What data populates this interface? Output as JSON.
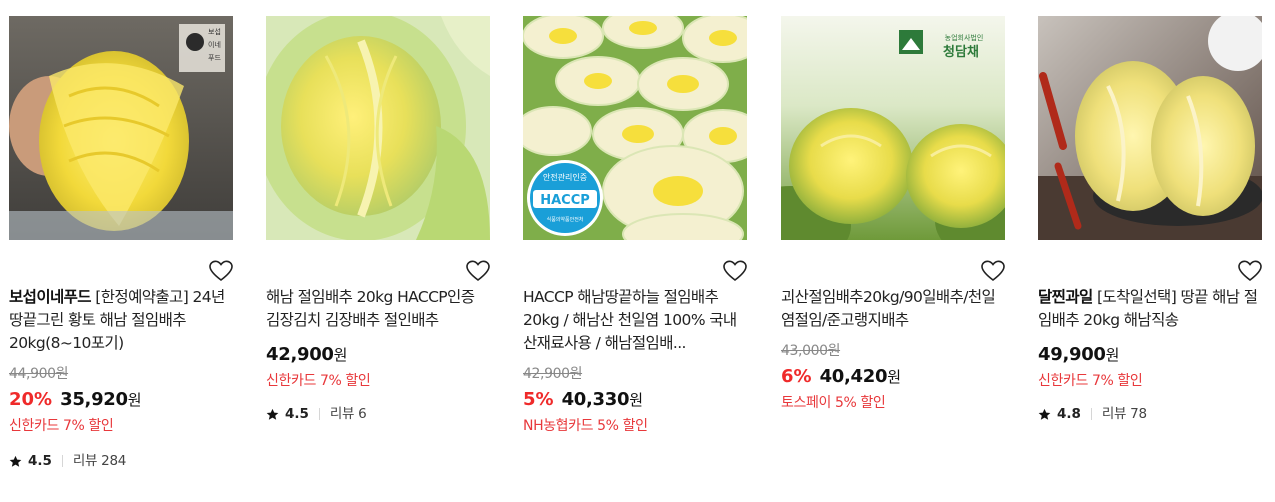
{
  "products": [
    {
      "seller": "보섭이네푸드",
      "name": " [한정예약출고] 24년 땅끝그린 황토 해남 절임배추 20kg(8~10포기)",
      "original_price": "44,900원",
      "discount_rate": "20%",
      "price": "35,920",
      "currency": "원",
      "promo": "신한카드 7% 할인",
      "rating": "4.5",
      "review_label": "리뷰 284",
      "brand_stamp": "보섭이네푸드"
    },
    {
      "seller": "",
      "name": "해남 절임배추 20kg HACCP인증 김장김치 김장배추 절인배추",
      "original_price": "",
      "discount_rate": "",
      "price": "42,900",
      "currency": "원",
      "promo": "신한카드 7% 할인",
      "rating": "4.5",
      "review_label": "리뷰 6"
    },
    {
      "seller": "",
      "name": "HACCP 해남땅끝하늘 절임배추 20kg / 해남산 천일염 100% 국내산재료사용 / 해남절임배...",
      "original_price": "42,900원",
      "discount_rate": "5%",
      "price": "40,330",
      "currency": "원",
      "promo": "NH농협카드 5% 할인",
      "rating": "",
      "review_label": "",
      "haccp_badge": {
        "top": "안전관리인증",
        "main": "HACCP",
        "bottom": "식품의약품안전처"
      }
    },
    {
      "seller": "",
      "name": "괴산절임배추20kg/90일배추/천일염절임/준고랭지배추",
      "original_price": "43,000원",
      "discount_rate": "6%",
      "price": "40,420",
      "currency": "원",
      "promo": "토스페이 5% 할인",
      "rating": "",
      "review_label": "",
      "brand_logo": {
        "sub": "농업회사법인",
        "main": "청담채"
      }
    },
    {
      "seller": "달찐과일",
      "name": " [도착일선택] 땅끝 해남 절임배추 20kg 해남직송",
      "original_price": "",
      "discount_rate": "",
      "price": "49,900",
      "currency": "원",
      "promo": "신한카드 7% 할인",
      "rating": "4.8",
      "review_label": "리뷰 78"
    }
  ],
  "icons": {
    "wishlist": "heart-outline-icon",
    "rating": "star-icon"
  },
  "colors": {
    "discount": "#ef2a2a",
    "promo": "#e8383b",
    "haccp": "#1a9fd8",
    "brand_green": "#2d7a3a"
  }
}
